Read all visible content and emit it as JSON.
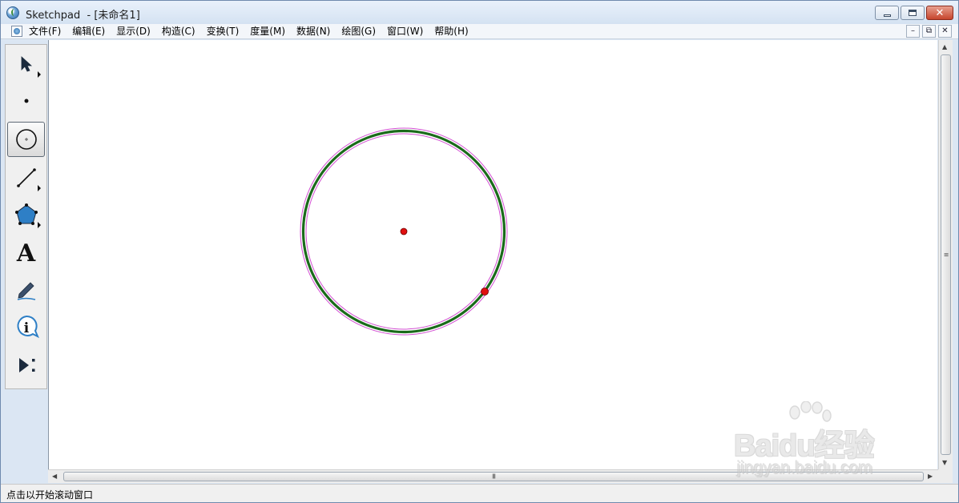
{
  "window": {
    "title": "Sketchpad  - [未命名1]",
    "controls": {
      "minimize": "minimize",
      "maximize": "maximize",
      "close": "✕"
    }
  },
  "menubar": {
    "items": [
      "文件(F)",
      "编辑(E)",
      "显示(D)",
      "构造(C)",
      "变换(T)",
      "度量(M)",
      "数据(N)",
      "绘图(G)",
      "窗口(W)",
      "帮助(H)"
    ],
    "mdi_controls": [
      "–",
      "⧉",
      "✕"
    ]
  },
  "toolbox": {
    "tools": [
      {
        "name": "arrow-tool",
        "has_submenu": true,
        "selected": false
      },
      {
        "name": "point-tool",
        "has_submenu": false,
        "selected": false
      },
      {
        "name": "compass-tool",
        "has_submenu": false,
        "selected": true
      },
      {
        "name": "straightedge-tool",
        "has_submenu": true,
        "selected": false
      },
      {
        "name": "polygon-tool",
        "has_submenu": true,
        "selected": false
      },
      {
        "name": "text-tool",
        "label": "A",
        "has_submenu": false,
        "selected": false
      },
      {
        "name": "marker-tool",
        "has_submenu": false,
        "selected": false
      },
      {
        "name": "information-tool",
        "has_submenu": false,
        "selected": false
      },
      {
        "name": "custom-tool",
        "has_submenu": false,
        "selected": false
      }
    ]
  },
  "sketch": {
    "objects": [
      {
        "type": "circle",
        "color": "#1a6b1a",
        "highlight_color": "#d24fd2",
        "selected": true
      },
      {
        "type": "point",
        "role": "center",
        "color": "#e01010"
      },
      {
        "type": "point",
        "role": "on-circle",
        "color": "#e01010"
      }
    ]
  },
  "scrollbars": {
    "vertical_grip": "≡",
    "horizontal_grip": "III"
  },
  "status": {
    "text": "点击以开始滚动窗口"
  },
  "watermark": {
    "brand": "Baidu经验",
    "url": "jingyan.baidu.com"
  },
  "colors": {
    "titlebar": "#dbe6f3",
    "canvas": "#ffffff",
    "circle": "#1a6b1a",
    "point": "#e01010"
  }
}
